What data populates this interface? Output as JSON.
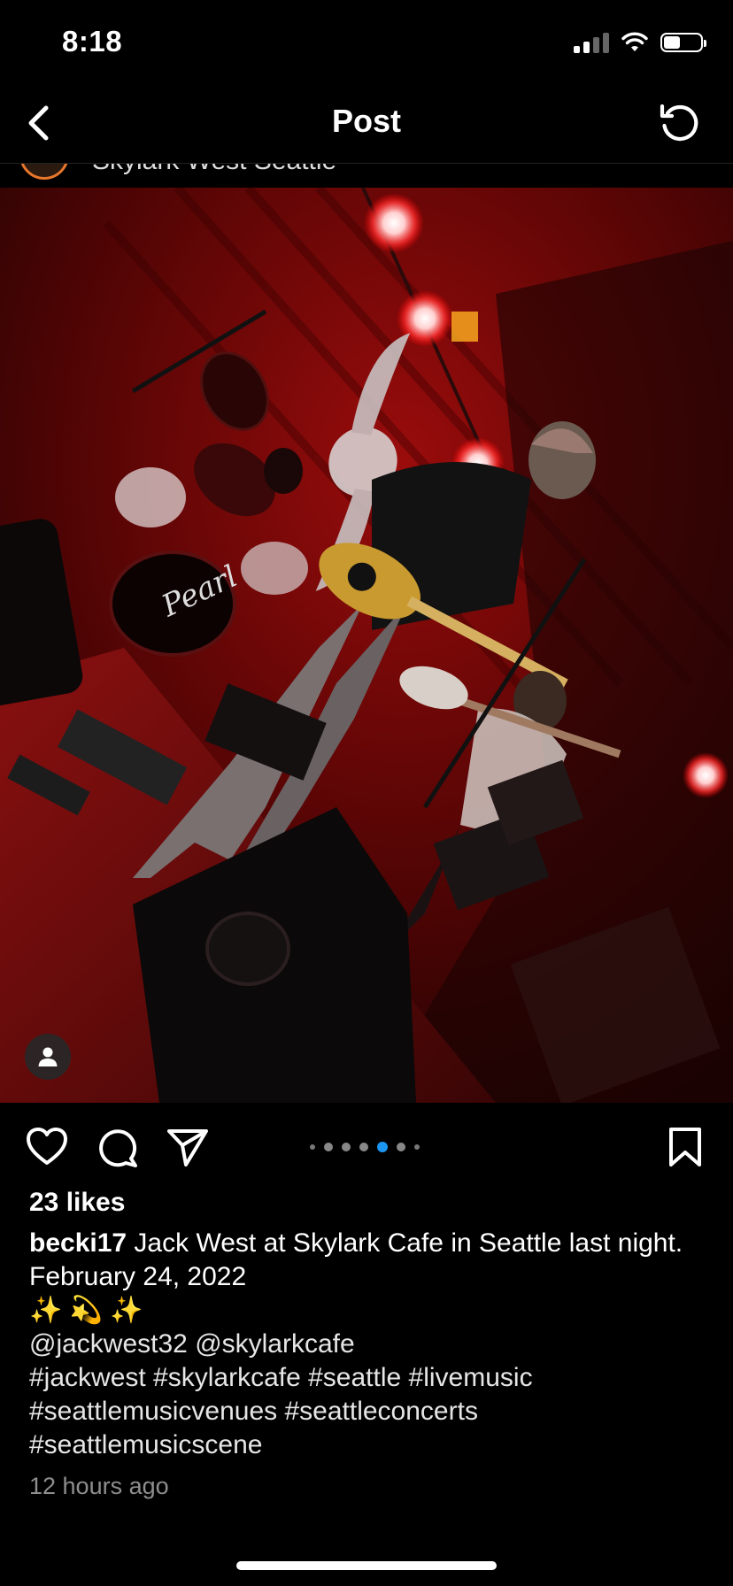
{
  "status_bar": {
    "time": "8:18",
    "battery_level": 0.45
  },
  "nav": {
    "title": "Post"
  },
  "post_header": {
    "location": "Skylark West Seattle"
  },
  "carousel": {
    "total_images": 7,
    "active_index": 4
  },
  "icons": {
    "back": "chevron-left-icon",
    "refresh": "refresh-icon",
    "like": "heart-icon",
    "comment": "comment-icon",
    "share": "send-icon",
    "save": "bookmark-icon",
    "tag": "person-icon"
  },
  "post": {
    "likes": "23 likes",
    "username": "becki17",
    "caption_text": " Jack West at Skylark Cafe in Seattle last night.",
    "date_line": "February 24, 2022",
    "emoji_line": "✨ 💫 ✨",
    "mentions": "@jackwest32 @skylarkcafe",
    "hashtags_1": "#jackwest #skylarkcafe #seattle #livemusic",
    "hashtags_2": "#seattlemusicvenues #seattleconcerts",
    "hashtags_3": "#seattlemusicscene",
    "time_ago": "12 hours ago"
  },
  "colors": {
    "background": "#000000",
    "accent_blue": "#1c96f0",
    "stage_red": "#c01010",
    "muted_text": "#8e8e8e"
  }
}
